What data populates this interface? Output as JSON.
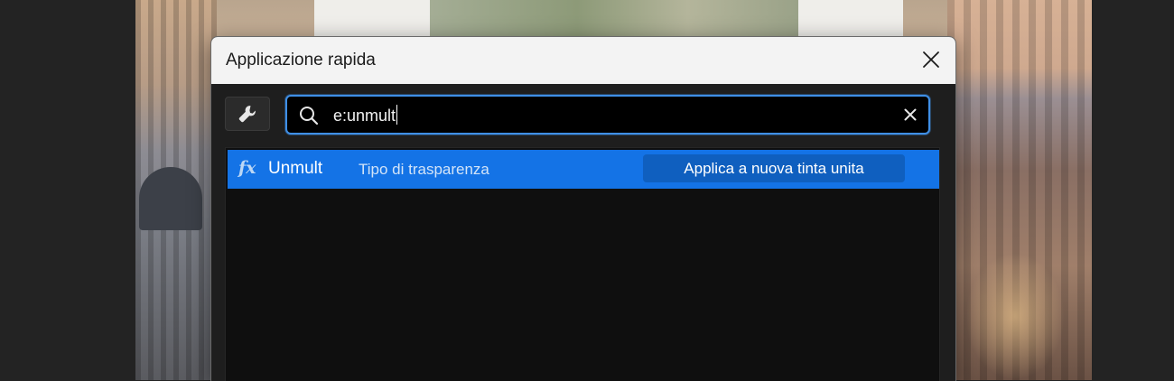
{
  "dialog": {
    "title": "Applicazione rapida",
    "close_icon": "close-icon",
    "tool_icon": "wrench-icon"
  },
  "search": {
    "value": "e:unmult",
    "icon": "search-icon",
    "clear_icon": "clear-icon"
  },
  "results": [
    {
      "icon": "fx-icon",
      "icon_text": "fx",
      "name": "Unmult",
      "category": "Tipo di trasparenza",
      "action": "Applica a nuova tinta unita",
      "selected": true
    }
  ],
  "colors": {
    "accent": "#1473e6",
    "focus_ring": "#3f8fe6",
    "dialog_bg": "#1e1e1e",
    "titlebar_bg": "#f3f3f3"
  }
}
